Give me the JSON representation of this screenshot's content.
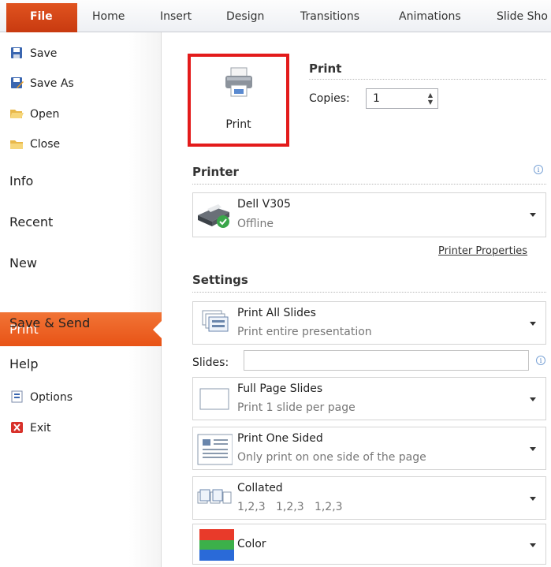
{
  "ribbon": {
    "tabs": [
      "File",
      "Home",
      "Insert",
      "Design",
      "Transitions",
      "Animations",
      "Slide Sho"
    ]
  },
  "nav": {
    "save": "Save",
    "save_as": "Save As",
    "open": "Open",
    "close": "Close",
    "info": "Info",
    "recent": "Recent",
    "new": "New",
    "print": "Print",
    "save_send": "Save & Send",
    "help": "Help",
    "options": "Options",
    "exit": "Exit"
  },
  "print_section": {
    "header": "Print",
    "button_label": "Print",
    "copies_label": "Copies:",
    "copies_value": "1"
  },
  "printer": {
    "header": "Printer",
    "name": "Dell V305",
    "status": "Offline",
    "properties_link": "Printer Properties"
  },
  "settings": {
    "header": "Settings",
    "slides_label": "Slides:",
    "slides_value": "",
    "items": [
      {
        "title": "Print All Slides",
        "sub": "Print entire presentation"
      },
      {
        "title": "Full Page Slides",
        "sub": "Print 1 slide per page"
      },
      {
        "title": "Print One Sided",
        "sub": "Only print on one side of the page"
      },
      {
        "title": "Collated",
        "sub": "1,2,3   1,2,3   1,2,3"
      },
      {
        "title": "Color",
        "sub": ""
      }
    ]
  },
  "colors": {
    "accent": "#e85316",
    "highlight_border": "#e31b1b"
  }
}
